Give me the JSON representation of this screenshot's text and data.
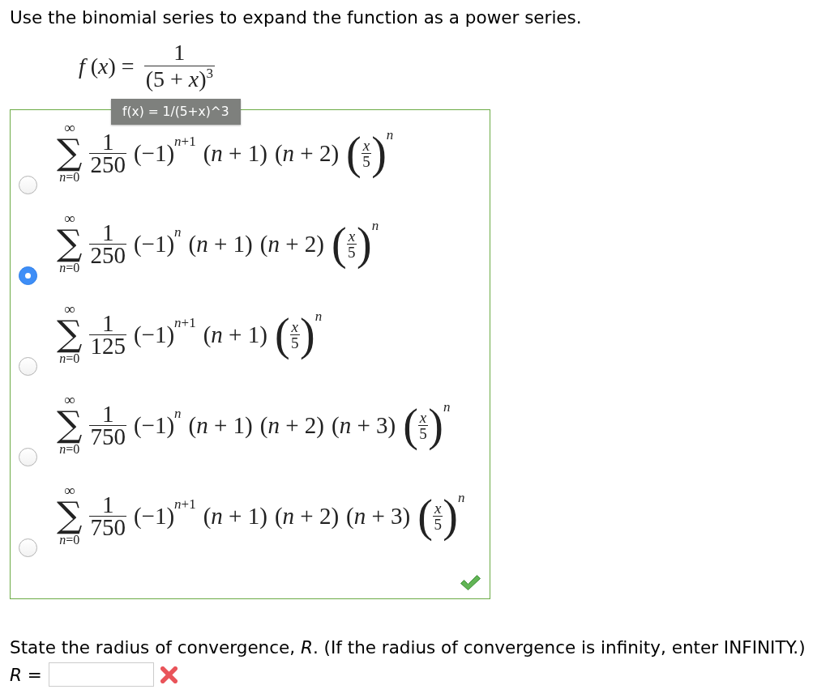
{
  "question": {
    "text": "Use the binomial series to expand the function as a power series."
  },
  "function": {
    "lhs": "*f* (*x*) =",
    "numerator": "1",
    "denominator": "(5 + *x*)$^{3}$"
  },
  "tooltip": {
    "text": "f(x) = 1/(5+x)^3"
  },
  "options": [
    {
      "selected": false,
      "upper_limit": "∞",
      "summation": "∑",
      "lower_limit": "*n*=0",
      "coefficient": {
        "numerator": "1",
        "denominator": "250"
      },
      "terms": [
        {
          "kind": "power",
          "base": "(−1)",
          "exponent": {
            "variable": "n",
            "offset": "+1"
          }
        },
        {
          "kind": "factor",
          "text": "(*n* + 1)"
        },
        {
          "kind": "factor",
          "text": "(*n* + 2)"
        },
        {
          "kind": "fraction_power",
          "open": "(",
          "numerator": "x",
          "denominator": "5",
          "close": ")",
          "exponent": "n"
        }
      ]
    },
    {
      "selected": true,
      "upper_limit": "∞",
      "summation": "∑",
      "lower_limit": "*n*=0",
      "coefficient": {
        "numerator": "1",
        "denominator": "250"
      },
      "terms": [
        {
          "kind": "power",
          "base": "(−1)",
          "exponent": {
            "variable": "n"
          }
        },
        {
          "kind": "factor",
          "text": "(*n* + 1)"
        },
        {
          "kind": "factor",
          "text": "(*n* + 2)"
        },
        {
          "kind": "fraction_power",
          "open": "(",
          "numerator": "x",
          "denominator": "5",
          "close": ")",
          "exponent": "n"
        }
      ]
    },
    {
      "selected": false,
      "upper_limit": "∞",
      "summation": "∑",
      "lower_limit": "*n*=0",
      "coefficient": {
        "numerator": "1",
        "denominator": "125"
      },
      "terms": [
        {
          "kind": "power",
          "base": "(−1)",
          "exponent": {
            "variable": "n",
            "offset": "+1"
          }
        },
        {
          "kind": "factor",
          "text": "(*n* + 1)"
        },
        {
          "kind": "fraction_power",
          "open": "(",
          "numerator": "x",
          "denominator": "5",
          "close": ")",
          "exponent": "n"
        }
      ]
    },
    {
      "selected": false,
      "upper_limit": "∞",
      "summation": "∑",
      "lower_limit": "*n*=0",
      "coefficient": {
        "numerator": "1",
        "denominator": "750"
      },
      "terms": [
        {
          "kind": "power",
          "base": "(−1)",
          "exponent": {
            "variable": "n"
          }
        },
        {
          "kind": "factor",
          "text": "(*n* + 1)"
        },
        {
          "kind": "factor",
          "text": "(*n* + 2)"
        },
        {
          "kind": "factor",
          "text": "(*n* + 3)"
        },
        {
          "kind": "fraction_power",
          "open": "(",
          "numerator": "x",
          "denominator": "5",
          "close": ")",
          "exponent": "n"
        }
      ]
    },
    {
      "selected": false,
      "upper_limit": "∞",
      "summation": "∑",
      "lower_limit": "*n*=0",
      "coefficient": {
        "numerator": "1",
        "denominator": "750"
      },
      "terms": [
        {
          "kind": "power",
          "base": "(−1)",
          "exponent": {
            "variable": "n",
            "offset": "+1"
          }
        },
        {
          "kind": "factor",
          "text": "(*n* + 1)"
        },
        {
          "kind": "factor",
          "text": "(*n* + 2)"
        },
        {
          "kind": "factor",
          "text": "(*n* + 3)"
        },
        {
          "kind": "fraction_power",
          "open": "(",
          "numerator": "x",
          "denominator": "5",
          "close": ")",
          "exponent": "n"
        }
      ]
    }
  ],
  "choices_feedback": {
    "correct": true
  },
  "radius": {
    "prompt": "State the radius of convergence, *R*. (If the radius of convergence is infinity, enter INFINITY.)",
    "label": "*R* =",
    "correct": false
  }
}
